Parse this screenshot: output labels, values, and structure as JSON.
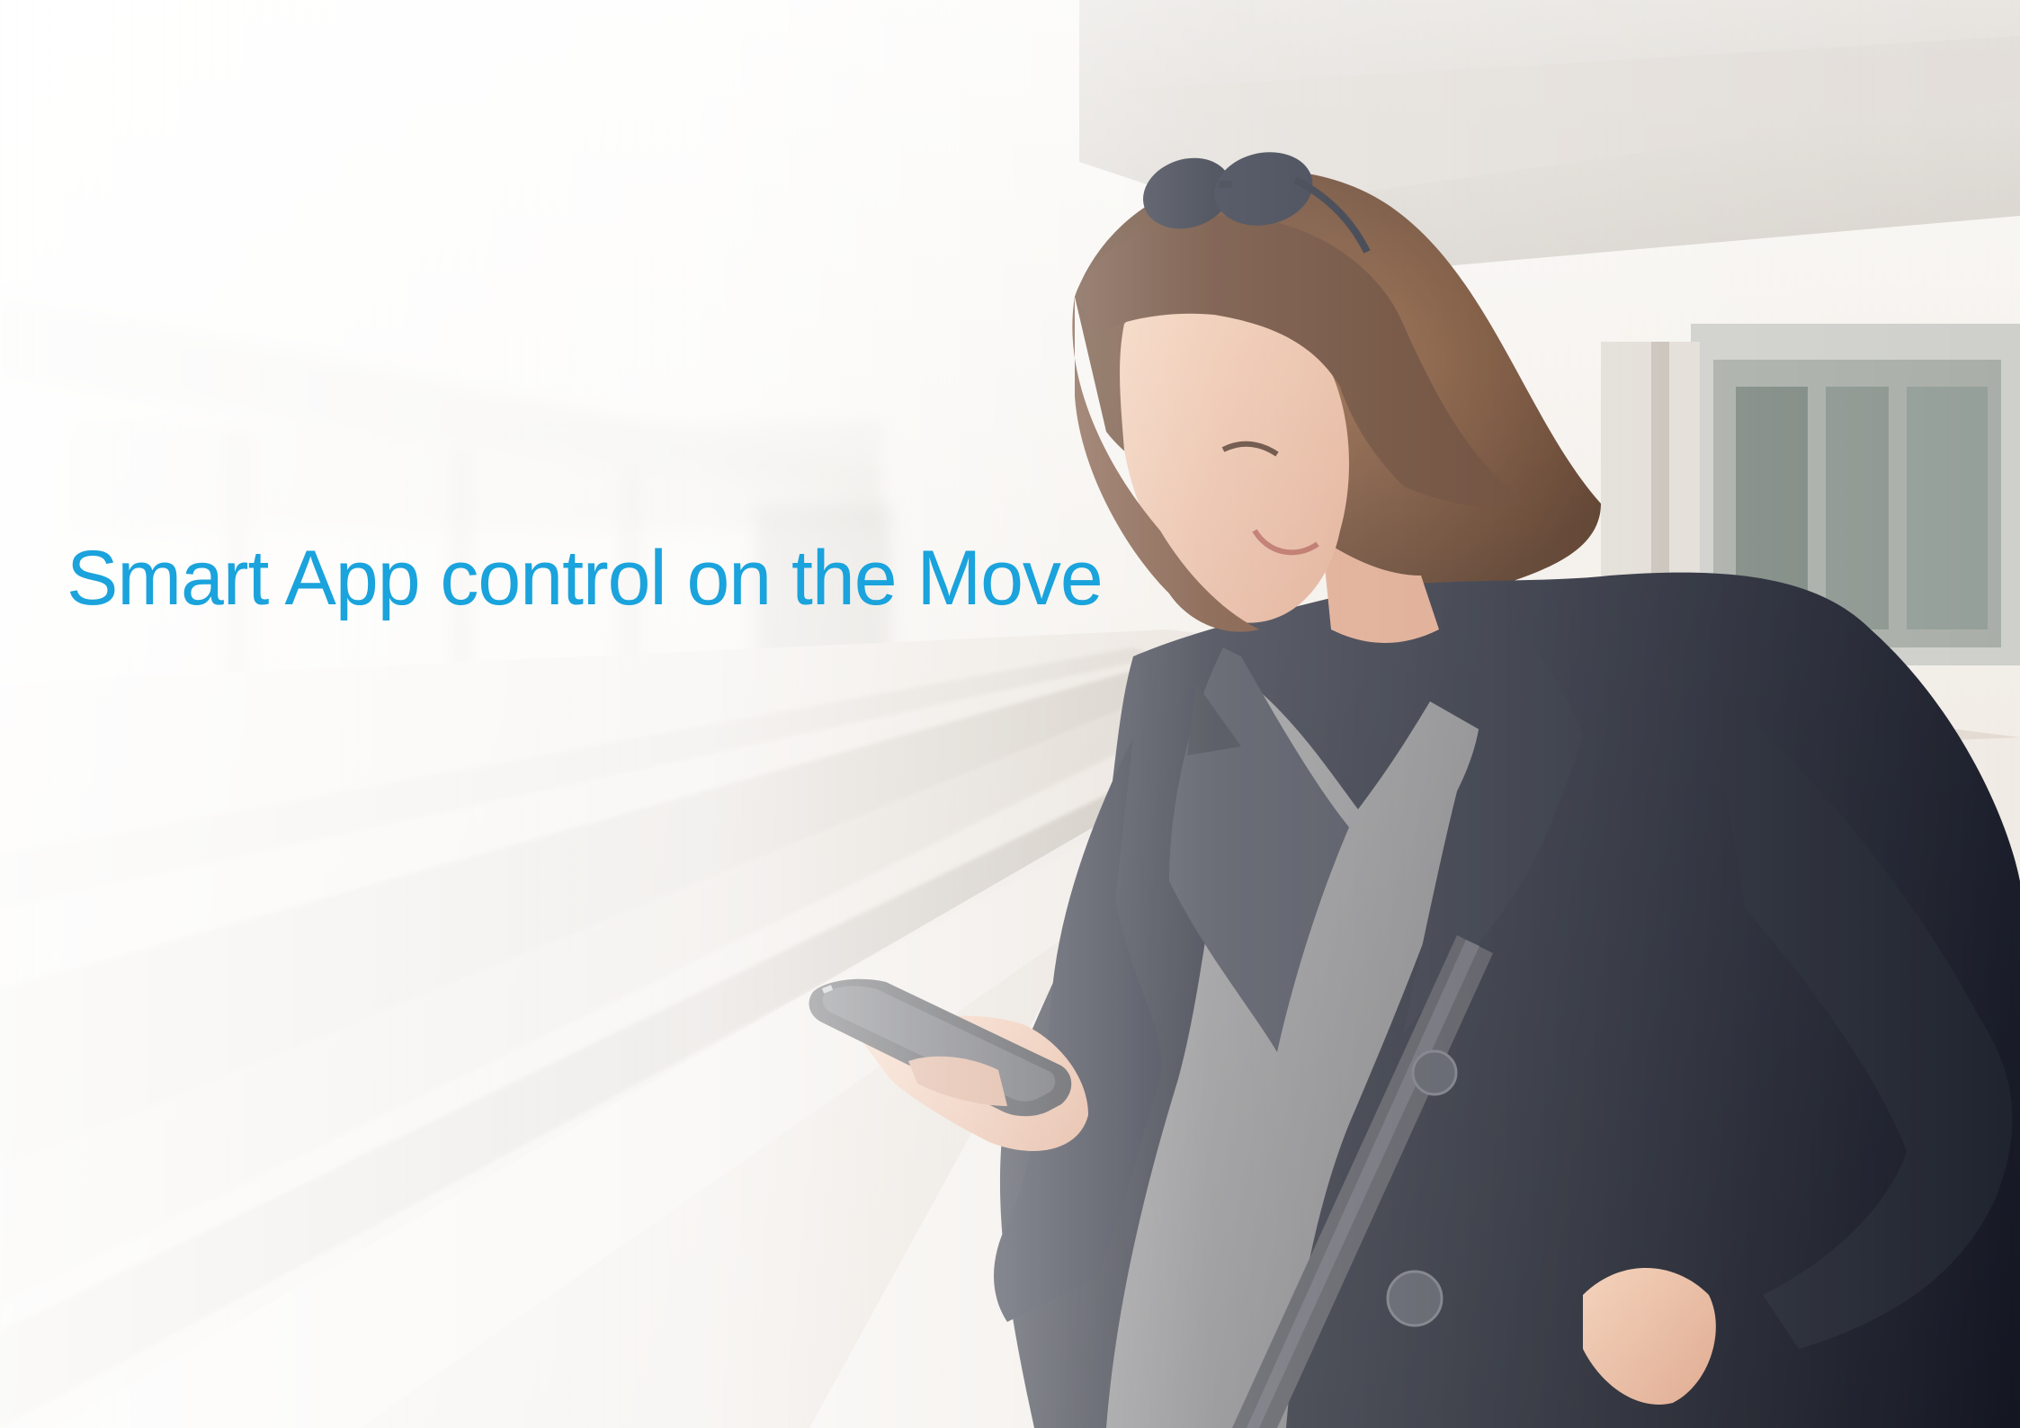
{
  "headline": {
    "text": "Smart App control on the Move",
    "color": "#1aa3dc"
  },
  "photo": {
    "subject": "woman-using-smartphone",
    "setting": "railway-platform"
  },
  "colors": {
    "coat": "#1c1f2b",
    "sweater": "#7d7d7f",
    "hair": "#6b4025",
    "skin": "#e9b89b",
    "background_fade": "#fbf9f6"
  }
}
